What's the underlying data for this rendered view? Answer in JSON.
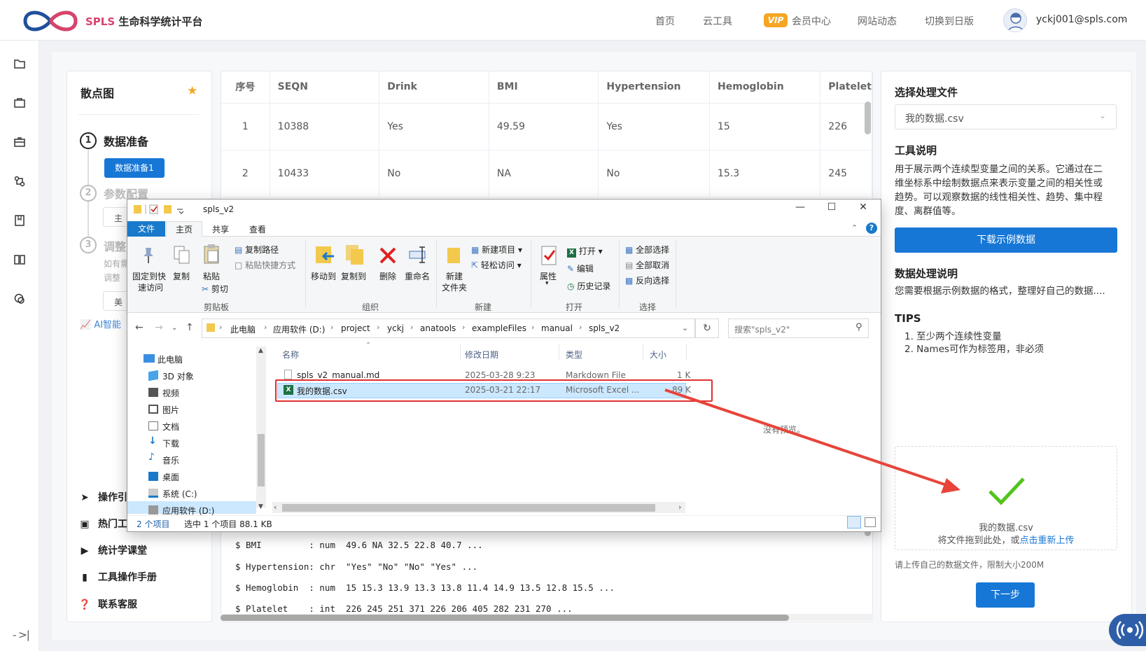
{
  "header": {
    "logo_en": "SPLS",
    "logo_cn": "生命科学统计平台",
    "nav": [
      "首页",
      "云工具",
      "会员中心",
      "网站动态",
      "切换到日版"
    ],
    "vip_badge": "VIP",
    "user_email": "yckj001@spls.com"
  },
  "left_panel": {
    "title": "散点图",
    "steps": [
      {
        "num": "1",
        "label": "数据准备",
        "button": "数据准备1"
      },
      {
        "num": "2",
        "label": "参数配置",
        "frag_a": "主"
      },
      {
        "num": "3",
        "label": "调整",
        "frag_a": "如有需",
        "frag_b": "调整",
        "frag_c": "美"
      }
    ],
    "ai_label": "AI智能",
    "links": [
      "操作引",
      "热门工",
      "统计学课堂",
      "工具操作手册",
      "联系客服"
    ]
  },
  "table": {
    "headers": [
      "序号",
      "SEQN",
      "Drink",
      "BMI",
      "Hypertension",
      "Hemoglobin",
      "Platelet"
    ],
    "rows": [
      [
        "1",
        "10388",
        "Yes",
        "49.59",
        "Yes",
        "15",
        "226"
      ],
      [
        "2",
        "10433",
        "No",
        "NA",
        "No",
        "15.3",
        "245"
      ]
    ],
    "console": [
      "$ BMI         : num  49.6 NA 32.5 22.8 40.7 ...",
      "$ Hypertension: chr  \"Yes\" \"No\" \"No\" \"Yes\" ...",
      "$ Hemoglobin  : num  15 15.3 13.9 13.3 13.8 11.4 14.9 13.5 12.8 15.5 ...",
      "$ Platelet    : int  226 245 251 371 226 206 405 282 231 270 ..."
    ]
  },
  "right_panel": {
    "select_title": "选择处理文件",
    "selected_file": "我的数据.csv",
    "tool_title": "工具说明",
    "tool_desc": "用于展示两个连续型变量之间的关系。它通过在二维坐标系中绘制数据点来表示变量之间的相关性或趋势。可以观察数据的线性相关性、趋势、集中程度、离群值等。",
    "download_btn": "下载示例数据",
    "proc_title": "数据处理说明",
    "proc_desc": "您需要根据示例数据的格式，整理好自己的数据....",
    "tips_title": "TIPS",
    "tips": [
      "1. 至少两个连续性变量",
      "2. Names可作为标签用，非必须"
    ],
    "upload_file": "我的数据.csv",
    "upload_hint": "将文件拖到此处，或",
    "upload_link": "点击重新上传",
    "upload_limit": "请上传自己的数据文件，限制大小200M",
    "next_btn": "下一步"
  },
  "explorer": {
    "title": "spls_v2",
    "tabs": [
      "文件",
      "主页",
      "共享",
      "查看"
    ],
    "ribbon": {
      "pin": [
        "固定到快",
        "速访问"
      ],
      "copy": "复制",
      "paste": "粘贴",
      "copy_path": "复制路径",
      "paste_shortcut": "粘贴快捷方式",
      "cut": "剪切",
      "move_to": "移动到",
      "copy_to": "复制到",
      "delete": "删除",
      "rename": "重命名",
      "new_folder": [
        "新建",
        "文件夹"
      ],
      "new_item": "新建项目",
      "easy_access": "轻松访问",
      "properties": "属性",
      "open": "打开",
      "edit": "编辑",
      "history": "历史记录",
      "select_all": "全部选择",
      "select_none": "全部取消",
      "invert": "反向选择",
      "groups": [
        "剪贴板",
        "组织",
        "新建",
        "打开",
        "选择"
      ]
    },
    "breadcrumbs": [
      "此电脑",
      "应用软件 (D:)",
      "project",
      "yckj",
      "anatools",
      "exampleFiles",
      "manual",
      "spls_v2"
    ],
    "search_placeholder": "搜索\"spls_v2\"",
    "tree": [
      "此电脑",
      "3D 对象",
      "视频",
      "图片",
      "文档",
      "下载",
      "音乐",
      "桌面",
      "系统 (C:)",
      "应用软件 (D:)"
    ],
    "columns": [
      "名称",
      "修改日期",
      "类型",
      "大小"
    ],
    "files": [
      {
        "name": "spls_v2_manual.md",
        "date": "2025-03-28 9:23",
        "type": "Markdown File",
        "size": "1 K"
      },
      {
        "name": "我的数据.csv",
        "date": "2025-03-21 22:17",
        "type": "Microsoft Excel ...",
        "size": "89 K"
      }
    ],
    "no_preview": "没有预览。",
    "status": [
      "2 个项目",
      "选中 1 个项目  88.1 KB"
    ]
  }
}
